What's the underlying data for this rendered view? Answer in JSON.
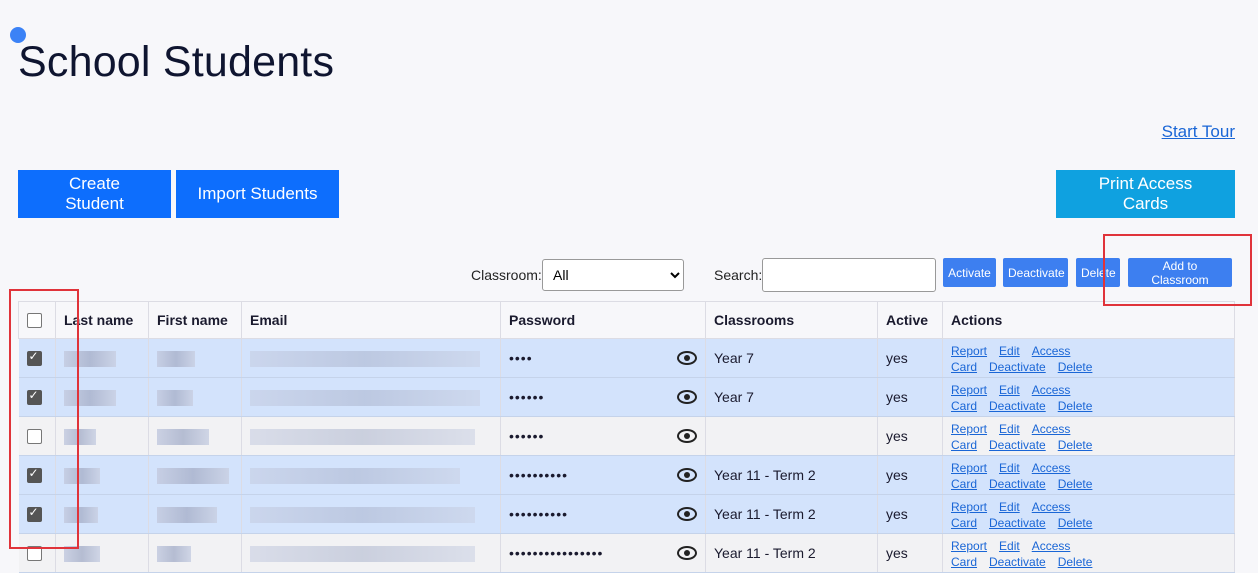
{
  "page": {
    "title": "School Students",
    "start_tour": "Start Tour"
  },
  "toolbar": {
    "create": "Create Student",
    "import": "Import Students",
    "print": "Print Access Cards"
  },
  "filters": {
    "classroom_label": "Classroom:",
    "classroom_value": "All",
    "search_label": "Search:"
  },
  "bulk": {
    "activate": "Activate",
    "deactivate": "Deactivate",
    "delete": "Delete",
    "add_to_classroom": "Add to Classroom"
  },
  "columns": [
    "Last name",
    "First name",
    "Email",
    "Password",
    "Classrooms",
    "Active",
    "Actions"
  ],
  "action_labels": [
    "Report",
    "Edit",
    "Access Card",
    "Deactivate",
    "Delete"
  ],
  "rows": [
    {
      "checked": true,
      "password": "••••",
      "classroom": "Year 7",
      "active": "yes"
    },
    {
      "checked": true,
      "password": "••••••",
      "classroom": "Year 7",
      "active": "yes"
    },
    {
      "checked": false,
      "password": "••••••",
      "classroom": "",
      "active": "yes"
    },
    {
      "checked": true,
      "password": "••••••••••",
      "classroom": "Year 11 - Term 2",
      "active": "yes"
    },
    {
      "checked": true,
      "password": "••••••••••",
      "classroom": "Year 11 - Term 2",
      "active": "yes"
    },
    {
      "checked": false,
      "password": "••••••••••••••••",
      "classroom": "Year 11 - Term 2",
      "active": "yes"
    }
  ],
  "colors": {
    "primary": "#0d6efd",
    "cyan": "#0fa1e0",
    "highlight": "#e0333a",
    "selected_row": "#d3e3fc"
  }
}
